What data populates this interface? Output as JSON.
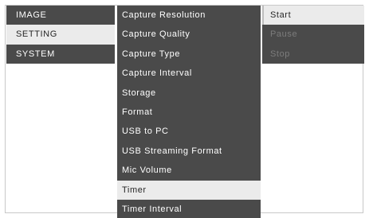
{
  "main_menu": {
    "items": [
      {
        "label": "IMAGE",
        "selected": false
      },
      {
        "label": "SETTING",
        "selected": true
      },
      {
        "label": "SYSTEM",
        "selected": false
      }
    ]
  },
  "setting_menu": {
    "items": [
      {
        "label": "Capture Resolution",
        "selected": false
      },
      {
        "label": "Capture Quality",
        "selected": false
      },
      {
        "label": "Capture Type",
        "selected": false
      },
      {
        "label": "Capture Interval",
        "selected": false
      },
      {
        "label": "Storage",
        "selected": false
      },
      {
        "label": "Format",
        "selected": false
      },
      {
        "label": "USB to PC",
        "selected": false
      },
      {
        "label": "USB Streaming Format",
        "selected": false
      },
      {
        "label": "Mic Volume",
        "selected": false
      },
      {
        "label": "Timer",
        "selected": true
      },
      {
        "label": "Timer Interval",
        "selected": false
      }
    ]
  },
  "timer_menu": {
    "items": [
      {
        "label": "Start",
        "state": "selected"
      },
      {
        "label": "Pause",
        "state": "disabled"
      },
      {
        "label": "Stop",
        "state": "disabled"
      }
    ]
  },
  "colors": {
    "menu_background": "#4a4a4a",
    "selected_background": "#ebebeb",
    "selected_text": "#262626",
    "normal_text": "#ffffff",
    "disabled_text": "#7c7c7c"
  }
}
